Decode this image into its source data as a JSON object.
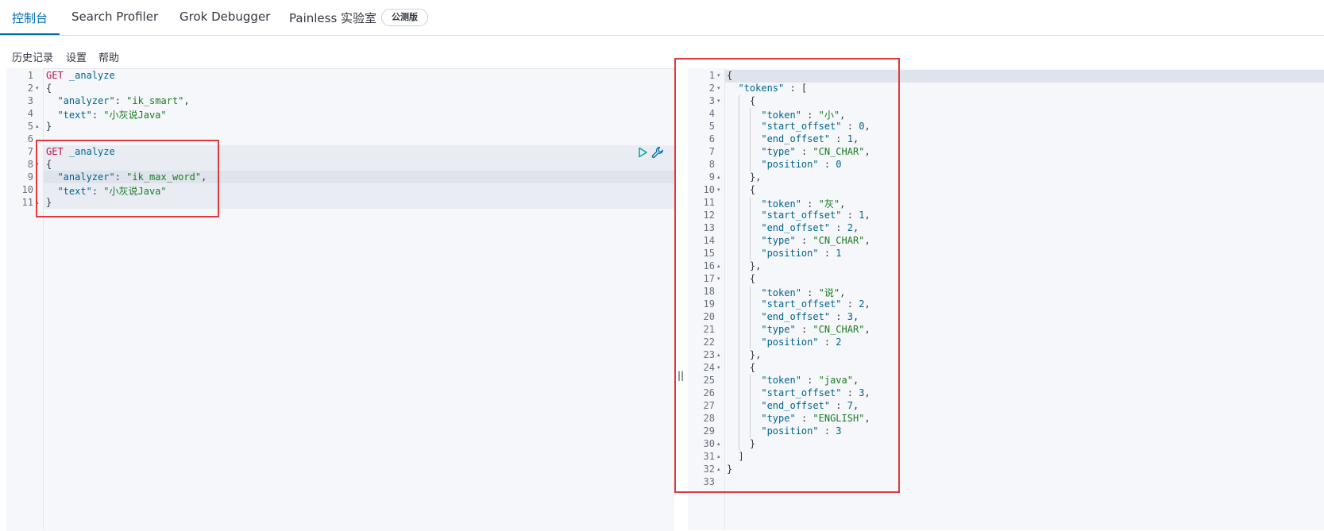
{
  "tabs": [
    {
      "label": "控制台"
    },
    {
      "label": "Search Profiler"
    },
    {
      "label": "Grok Debugger"
    },
    {
      "label": "Painless 实验室"
    }
  ],
  "beta_badge": "公测版",
  "toolbar": {
    "history": "历史记录",
    "settings": "设置",
    "help": "帮助"
  },
  "request_editor": {
    "lines": [
      {
        "n": "1",
        "fold": "",
        "tokens": [
          [
            "c-method",
            "GET"
          ],
          [
            "c-punc",
            " "
          ],
          [
            "c-path",
            "_analyze"
          ]
        ]
      },
      {
        "n": "2",
        "fold": "▾",
        "tokens": [
          [
            "c-punc",
            "{"
          ]
        ]
      },
      {
        "n": "3",
        "fold": "",
        "tokens": [
          [
            "c-punc",
            "  "
          ],
          [
            "c-key",
            "\"analyzer\""
          ],
          [
            "c-punc",
            ": "
          ],
          [
            "c-str",
            "\"ik_smart\""
          ],
          [
            "c-punc",
            ","
          ]
        ]
      },
      {
        "n": "4",
        "fold": "",
        "tokens": [
          [
            "c-punc",
            "  "
          ],
          [
            "c-key",
            "\"text\""
          ],
          [
            "c-punc",
            ": "
          ],
          [
            "c-str",
            "\"小灰说Java\""
          ]
        ]
      },
      {
        "n": "5",
        "fold": "▴",
        "tokens": [
          [
            "c-punc",
            "}"
          ]
        ]
      },
      {
        "n": "6",
        "fold": "",
        "tokens": []
      },
      {
        "n": "7",
        "fold": "",
        "tokens": [
          [
            "c-method",
            "GET"
          ],
          [
            "c-punc",
            " "
          ],
          [
            "c-path",
            "_analyze"
          ]
        ]
      },
      {
        "n": "8",
        "fold": "▾",
        "tokens": [
          [
            "c-punc",
            "{"
          ]
        ]
      },
      {
        "n": "9",
        "fold": "",
        "tokens": [
          [
            "c-punc",
            "  "
          ],
          [
            "c-key",
            "\"analyzer\""
          ],
          [
            "c-punc",
            ": "
          ],
          [
            "c-str",
            "\"ik_max_word\""
          ],
          [
            "c-punc",
            ","
          ]
        ]
      },
      {
        "n": "10",
        "fold": "",
        "tokens": [
          [
            "c-punc",
            "  "
          ],
          [
            "c-key",
            "\"text\""
          ],
          [
            "c-punc",
            ": "
          ],
          [
            "c-str",
            "\"小灰说Java\""
          ]
        ]
      },
      {
        "n": "11",
        "fold": "▴",
        "tokens": [
          [
            "c-punc",
            "}"
          ]
        ]
      }
    ]
  },
  "response_editor": {
    "lines": [
      {
        "n": "1",
        "fold": "▾",
        "tokens": [
          [
            "c-punc",
            "{"
          ]
        ]
      },
      {
        "n": "2",
        "fold": "▾",
        "tokens": [
          [
            "c-punc",
            "  "
          ],
          [
            "c-key",
            "\"tokens\""
          ],
          [
            "c-punc",
            " : ["
          ]
        ]
      },
      {
        "n": "3",
        "fold": "▾",
        "tokens": [
          [
            "c-punc",
            "    {"
          ]
        ]
      },
      {
        "n": "4",
        "fold": "",
        "tokens": [
          [
            "c-punc",
            "      "
          ],
          [
            "c-key",
            "\"token\""
          ],
          [
            "c-punc",
            " : "
          ],
          [
            "c-str",
            "\"小\""
          ],
          [
            "c-punc",
            ","
          ]
        ]
      },
      {
        "n": "5",
        "fold": "",
        "tokens": [
          [
            "c-punc",
            "      "
          ],
          [
            "c-key",
            "\"start_offset\""
          ],
          [
            "c-punc",
            " : "
          ],
          [
            "c-num",
            "0"
          ],
          [
            "c-punc",
            ","
          ]
        ]
      },
      {
        "n": "6",
        "fold": "",
        "tokens": [
          [
            "c-punc",
            "      "
          ],
          [
            "c-key",
            "\"end_offset\""
          ],
          [
            "c-punc",
            " : "
          ],
          [
            "c-num",
            "1"
          ],
          [
            "c-punc",
            ","
          ]
        ]
      },
      {
        "n": "7",
        "fold": "",
        "tokens": [
          [
            "c-punc",
            "      "
          ],
          [
            "c-key",
            "\"type\""
          ],
          [
            "c-punc",
            " : "
          ],
          [
            "c-str",
            "\"CN_CHAR\""
          ],
          [
            "c-punc",
            ","
          ]
        ]
      },
      {
        "n": "8",
        "fold": "",
        "tokens": [
          [
            "c-punc",
            "      "
          ],
          [
            "c-key",
            "\"position\""
          ],
          [
            "c-punc",
            " : "
          ],
          [
            "c-num",
            "0"
          ]
        ]
      },
      {
        "n": "9",
        "fold": "▴",
        "tokens": [
          [
            "c-punc",
            "    },"
          ]
        ]
      },
      {
        "n": "10",
        "fold": "▾",
        "tokens": [
          [
            "c-punc",
            "    {"
          ]
        ]
      },
      {
        "n": "11",
        "fold": "",
        "tokens": [
          [
            "c-punc",
            "      "
          ],
          [
            "c-key",
            "\"token\""
          ],
          [
            "c-punc",
            " : "
          ],
          [
            "c-str",
            "\"灰\""
          ],
          [
            "c-punc",
            ","
          ]
        ]
      },
      {
        "n": "12",
        "fold": "",
        "tokens": [
          [
            "c-punc",
            "      "
          ],
          [
            "c-key",
            "\"start_offset\""
          ],
          [
            "c-punc",
            " : "
          ],
          [
            "c-num",
            "1"
          ],
          [
            "c-punc",
            ","
          ]
        ]
      },
      {
        "n": "13",
        "fold": "",
        "tokens": [
          [
            "c-punc",
            "      "
          ],
          [
            "c-key",
            "\"end_offset\""
          ],
          [
            "c-punc",
            " : "
          ],
          [
            "c-num",
            "2"
          ],
          [
            "c-punc",
            ","
          ]
        ]
      },
      {
        "n": "14",
        "fold": "",
        "tokens": [
          [
            "c-punc",
            "      "
          ],
          [
            "c-key",
            "\"type\""
          ],
          [
            "c-punc",
            " : "
          ],
          [
            "c-str",
            "\"CN_CHAR\""
          ],
          [
            "c-punc",
            ","
          ]
        ]
      },
      {
        "n": "15",
        "fold": "",
        "tokens": [
          [
            "c-punc",
            "      "
          ],
          [
            "c-key",
            "\"position\""
          ],
          [
            "c-punc",
            " : "
          ],
          [
            "c-num",
            "1"
          ]
        ]
      },
      {
        "n": "16",
        "fold": "▴",
        "tokens": [
          [
            "c-punc",
            "    },"
          ]
        ]
      },
      {
        "n": "17",
        "fold": "▾",
        "tokens": [
          [
            "c-punc",
            "    {"
          ]
        ]
      },
      {
        "n": "18",
        "fold": "",
        "tokens": [
          [
            "c-punc",
            "      "
          ],
          [
            "c-key",
            "\"token\""
          ],
          [
            "c-punc",
            " : "
          ],
          [
            "c-str",
            "\"说\""
          ],
          [
            "c-punc",
            ","
          ]
        ]
      },
      {
        "n": "19",
        "fold": "",
        "tokens": [
          [
            "c-punc",
            "      "
          ],
          [
            "c-key",
            "\"start_offset\""
          ],
          [
            "c-punc",
            " : "
          ],
          [
            "c-num",
            "2"
          ],
          [
            "c-punc",
            ","
          ]
        ]
      },
      {
        "n": "20",
        "fold": "",
        "tokens": [
          [
            "c-punc",
            "      "
          ],
          [
            "c-key",
            "\"end_offset\""
          ],
          [
            "c-punc",
            " : "
          ],
          [
            "c-num",
            "3"
          ],
          [
            "c-punc",
            ","
          ]
        ]
      },
      {
        "n": "21",
        "fold": "",
        "tokens": [
          [
            "c-punc",
            "      "
          ],
          [
            "c-key",
            "\"type\""
          ],
          [
            "c-punc",
            " : "
          ],
          [
            "c-str",
            "\"CN_CHAR\""
          ],
          [
            "c-punc",
            ","
          ]
        ]
      },
      {
        "n": "22",
        "fold": "",
        "tokens": [
          [
            "c-punc",
            "      "
          ],
          [
            "c-key",
            "\"position\""
          ],
          [
            "c-punc",
            " : "
          ],
          [
            "c-num",
            "2"
          ]
        ]
      },
      {
        "n": "23",
        "fold": "▴",
        "tokens": [
          [
            "c-punc",
            "    },"
          ]
        ]
      },
      {
        "n": "24",
        "fold": "▾",
        "tokens": [
          [
            "c-punc",
            "    {"
          ]
        ]
      },
      {
        "n": "25",
        "fold": "",
        "tokens": [
          [
            "c-punc",
            "      "
          ],
          [
            "c-key",
            "\"token\""
          ],
          [
            "c-punc",
            " : "
          ],
          [
            "c-str",
            "\"java\""
          ],
          [
            "c-punc",
            ","
          ]
        ]
      },
      {
        "n": "26",
        "fold": "",
        "tokens": [
          [
            "c-punc",
            "      "
          ],
          [
            "c-key",
            "\"start_offset\""
          ],
          [
            "c-punc",
            " : "
          ],
          [
            "c-num",
            "3"
          ],
          [
            "c-punc",
            ","
          ]
        ]
      },
      {
        "n": "27",
        "fold": "",
        "tokens": [
          [
            "c-punc",
            "      "
          ],
          [
            "c-key",
            "\"end_offset\""
          ],
          [
            "c-punc",
            " : "
          ],
          [
            "c-num",
            "7"
          ],
          [
            "c-punc",
            ","
          ]
        ]
      },
      {
        "n": "28",
        "fold": "",
        "tokens": [
          [
            "c-punc",
            "      "
          ],
          [
            "c-key",
            "\"type\""
          ],
          [
            "c-punc",
            " : "
          ],
          [
            "c-str",
            "\"ENGLISH\""
          ],
          [
            "c-punc",
            ","
          ]
        ]
      },
      {
        "n": "29",
        "fold": "",
        "tokens": [
          [
            "c-punc",
            "      "
          ],
          [
            "c-key",
            "\"position\""
          ],
          [
            "c-punc",
            " : "
          ],
          [
            "c-num",
            "3"
          ]
        ]
      },
      {
        "n": "30",
        "fold": "▴",
        "tokens": [
          [
            "c-punc",
            "    }"
          ]
        ]
      },
      {
        "n": "31",
        "fold": "▴",
        "tokens": [
          [
            "c-punc",
            "  ]"
          ]
        ]
      },
      {
        "n": "32",
        "fold": "▴",
        "tokens": [
          [
            "c-punc",
            "}"
          ]
        ]
      },
      {
        "n": "33",
        "fold": "",
        "tokens": []
      }
    ]
  },
  "icons": {
    "run": "play-icon",
    "wrench": "wrench-icon",
    "divider": "resize-handle-icon"
  },
  "colors": {
    "accent": "#006bb4",
    "highlight_box": "#e0393e",
    "method": "#bd0f4c",
    "string": "#1b7a22",
    "key": "#00648c"
  }
}
